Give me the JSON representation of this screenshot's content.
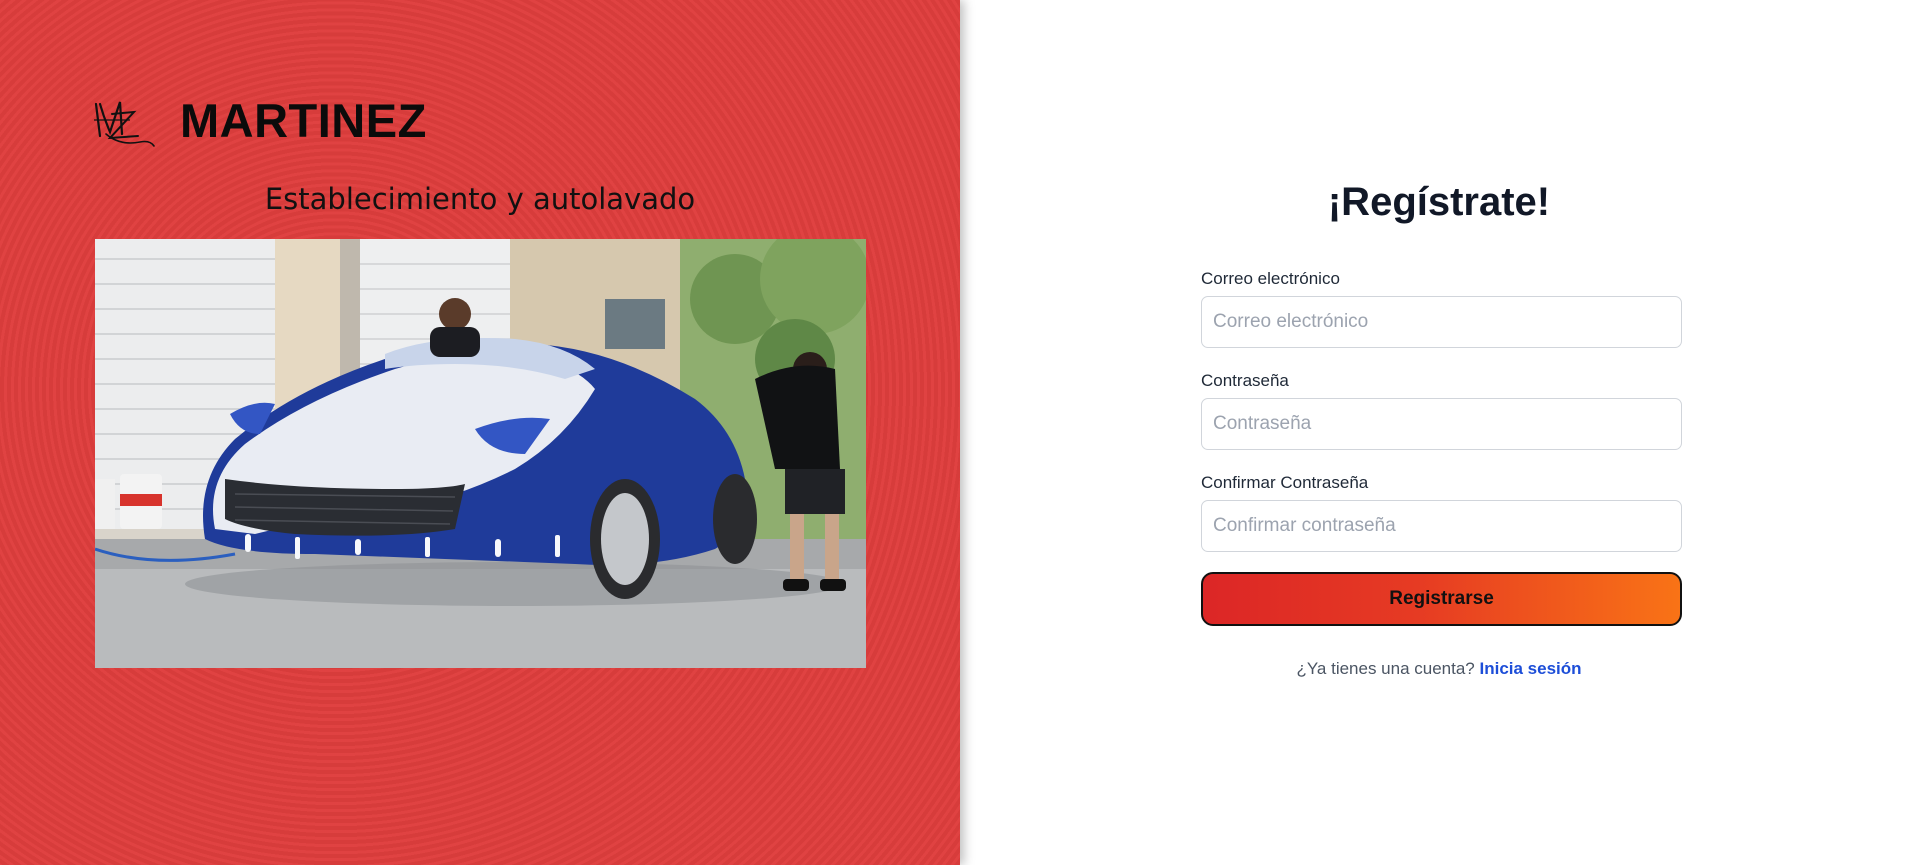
{
  "brand": {
    "name": "MARTINEZ",
    "subtitle": "Establecimiento y autolavado",
    "logo_icon": "mz-monogram-logo",
    "panel_color": "#df3e3d"
  },
  "hero_image": {
    "icon": "car-wash-photo"
  },
  "form": {
    "title": "¡Regístrate!",
    "email": {
      "label": "Correo electrónico",
      "placeholder": "Correo electrónico",
      "value": ""
    },
    "password": {
      "label": "Contraseña",
      "placeholder": "Contraseña",
      "value": ""
    },
    "confirm_password": {
      "label": "Confirmar Contraseña",
      "placeholder": "Confirmar contraseña",
      "value": ""
    },
    "submit_label": "Registrarse",
    "button_gradient": [
      "#dc2626",
      "#f97316"
    ],
    "login_prompt": "¿Ya tienes una cuenta?",
    "login_link": "Inicia sesión",
    "link_color": "#1d4ed8"
  }
}
